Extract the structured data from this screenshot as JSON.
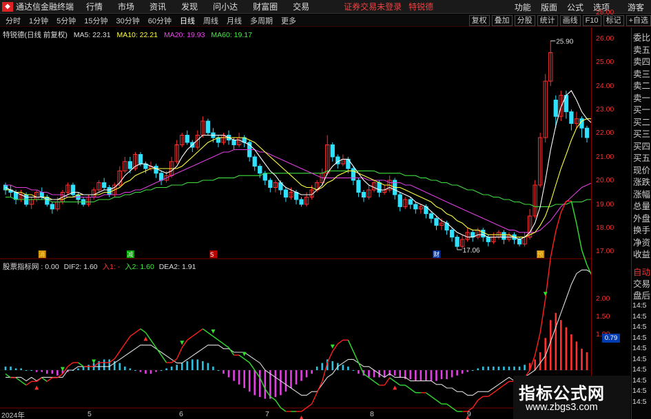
{
  "app": {
    "title": "通达信金融终端",
    "logo": "logo-icon"
  },
  "menu": [
    "行情",
    "市场",
    "资讯",
    "发现",
    "问小达",
    "财富圈",
    "交易"
  ],
  "login_text": "证券交易未登录",
  "stock_name": "特锐德",
  "top_right": [
    "功能",
    "版面",
    "公式",
    "选项"
  ],
  "guest": "游客",
  "periods": [
    "分时",
    "1分钟",
    "5分钟",
    "15分钟",
    "30分钟",
    "60分钟",
    "日线",
    "周线",
    "月线",
    "多周期",
    "更多"
  ],
  "active_period": "日线",
  "right_tools": [
    "复权",
    "叠加",
    "分股",
    "统计",
    "画线",
    "F10",
    "标记",
    "+自选"
  ],
  "legend": {
    "stock_label": "特锐德(日线 前复权)",
    "ma5": "MA5: 22.31",
    "ma10": "MA10: 22.21",
    "ma20": "MA20: 19.93",
    "ma60": "MA60: 19.17"
  },
  "indicator_legend": {
    "name": "股票指标网 : 0.00",
    "dif2": "DIF2: 1.60",
    "in1": "入1: -",
    "in2": "入2: 1.60",
    "dea2": "DEA2: 1.91"
  },
  "dea_box": "0.79",
  "right_panel_items": [
    "委比",
    "卖五",
    "卖四",
    "卖三",
    "卖二",
    "卖一",
    "买一",
    "买二",
    "买三",
    "买四",
    "买五",
    "现价",
    "涨跌",
    "涨幅",
    "总量",
    "外盘",
    "换手",
    "净资",
    "收益"
  ],
  "right_panel_lower": [
    "自动",
    "交易",
    "盘后"
  ],
  "right_panel_times": [
    "14:5",
    "14:5",
    "14:5",
    "14:5",
    "14:5",
    "14:5",
    "14:5",
    "14:5",
    "14:5",
    "14:5"
  ],
  "x_labels": [
    "2024年",
    "5",
    "6",
    "7",
    "8",
    "9"
  ],
  "event_markers": [
    "消",
    "减",
    "S",
    "财",
    "预"
  ],
  "price_labels": {
    "high": "25.90",
    "low": "17.06"
  },
  "watermark": {
    "title": "指标公式网",
    "url": "www.zbgs3.com"
  },
  "colors": {
    "up": "#ff3030",
    "down": "#30e0ff",
    "ma5": "#ffffff",
    "ma10": "#ffff40",
    "ma20": "#e040e0",
    "ma60": "#40e040",
    "dif": "#ffffff",
    "dea": "#ffff40",
    "grid": "#7a0000"
  },
  "chart_data": [
    {
      "type": "candlestick",
      "y_ticks": [
        17.0,
        18.0,
        19.0,
        20.0,
        21.0,
        22.0,
        23.0,
        24.0,
        25.0,
        26.0,
        28.0
      ],
      "ylim": [
        16.8,
        28.3
      ],
      "candles": [
        [
          19.8,
          19.6,
          19.9,
          19.4
        ],
        [
          19.6,
          19.5,
          19.8,
          19.3
        ],
        [
          19.5,
          19.2,
          19.6,
          19.0
        ],
        [
          19.2,
          19.4,
          19.6,
          19.1
        ],
        [
          19.4,
          19.0,
          19.5,
          18.9
        ],
        [
          19.0,
          19.2,
          19.3,
          18.8
        ],
        [
          19.2,
          19.5,
          19.6,
          19.1
        ],
        [
          19.5,
          19.3,
          19.7,
          19.2
        ],
        [
          19.3,
          19.0,
          19.4,
          18.9
        ],
        [
          19.0,
          18.8,
          19.1,
          18.6
        ],
        [
          18.8,
          19.1,
          19.3,
          18.7
        ],
        [
          19.1,
          19.5,
          19.6,
          19.0
        ],
        [
          19.5,
          19.8,
          19.9,
          19.4
        ],
        [
          19.8,
          19.4,
          19.9,
          19.3
        ],
        [
          19.4,
          19.2,
          19.5,
          19.0
        ],
        [
          19.2,
          19.0,
          19.3,
          18.9
        ],
        [
          19.0,
          19.3,
          19.4,
          18.9
        ],
        [
          19.3,
          19.6,
          19.7,
          19.2
        ],
        [
          19.6,
          19.9,
          20.0,
          19.5
        ],
        [
          19.9,
          19.7,
          20.1,
          19.6
        ],
        [
          19.7,
          19.4,
          19.8,
          19.3
        ],
        [
          19.4,
          19.8,
          19.9,
          19.3
        ],
        [
          19.8,
          20.4,
          20.6,
          19.7
        ],
        [
          20.4,
          20.8,
          21.0,
          20.3
        ],
        [
          20.8,
          20.5,
          21.0,
          20.3
        ],
        [
          20.5,
          21.1,
          21.2,
          20.4
        ],
        [
          21.1,
          20.7,
          21.2,
          20.6
        ],
        [
          20.7,
          20.5,
          20.8,
          20.3
        ],
        [
          20.5,
          20.6,
          20.8,
          20.4
        ],
        [
          20.6,
          20.3,
          20.7,
          20.1
        ],
        [
          20.3,
          20.0,
          20.4,
          19.8
        ],
        [
          20.0,
          20.2,
          20.4,
          19.9
        ],
        [
          20.2,
          20.8,
          21.0,
          20.1
        ],
        [
          20.8,
          21.5,
          21.7,
          20.7
        ],
        [
          21.5,
          21.9,
          22.0,
          21.4
        ],
        [
          21.9,
          21.6,
          22.1,
          21.5
        ],
        [
          21.6,
          21.4,
          21.7,
          21.2
        ],
        [
          21.4,
          21.9,
          22.1,
          21.3
        ],
        [
          21.9,
          22.5,
          22.7,
          21.8
        ],
        [
          22.5,
          22.0,
          22.6,
          21.9
        ],
        [
          22.0,
          21.8,
          22.2,
          21.6
        ],
        [
          21.8,
          21.6,
          21.9,
          21.4
        ],
        [
          21.6,
          21.9,
          22.0,
          21.5
        ],
        [
          21.9,
          21.7,
          22.1,
          21.5
        ],
        [
          21.7,
          21.5,
          21.8,
          21.3
        ],
        [
          21.5,
          21.8,
          22.0,
          21.4
        ],
        [
          21.8,
          21.6,
          21.9,
          21.4
        ],
        [
          21.6,
          21.0,
          21.7,
          20.8
        ],
        [
          21.0,
          20.6,
          21.1,
          20.4
        ],
        [
          20.6,
          20.3,
          20.7,
          20.1
        ],
        [
          20.3,
          20.0,
          20.4,
          19.8
        ],
        [
          20.0,
          19.7,
          20.1,
          19.5
        ],
        [
          19.7,
          19.9,
          20.0,
          19.5
        ],
        [
          19.9,
          19.6,
          20.0,
          19.4
        ],
        [
          19.6,
          19.3,
          19.7,
          19.1
        ],
        [
          19.3,
          19.5,
          19.7,
          19.2
        ],
        [
          19.5,
          19.2,
          19.6,
          19.0
        ],
        [
          19.2,
          19.0,
          19.3,
          18.9
        ],
        [
          19.0,
          19.3,
          19.5,
          18.9
        ],
        [
          19.3,
          19.6,
          19.8,
          19.2
        ],
        [
          19.6,
          19.9,
          20.0,
          19.5
        ],
        [
          19.9,
          20.3,
          20.5,
          19.8
        ],
        [
          20.3,
          21.5,
          21.9,
          20.2
        ],
        [
          21.5,
          21.0,
          21.6,
          20.8
        ],
        [
          21.0,
          20.7,
          21.1,
          20.5
        ],
        [
          20.7,
          20.9,
          21.1,
          20.6
        ],
        [
          20.9,
          20.5,
          21.0,
          20.3
        ],
        [
          20.5,
          20.0,
          20.6,
          19.8
        ],
        [
          20.0,
          19.5,
          20.1,
          19.3
        ],
        [
          19.5,
          19.3,
          19.6,
          19.1
        ],
        [
          19.3,
          19.6,
          19.8,
          19.2
        ],
        [
          19.6,
          19.9,
          20.0,
          19.5
        ],
        [
          19.9,
          19.5,
          20.0,
          19.3
        ],
        [
          19.5,
          19.6,
          19.8,
          19.4
        ],
        [
          19.6,
          20.0,
          20.2,
          19.5
        ],
        [
          20.0,
          19.4,
          20.1,
          19.2
        ],
        [
          19.4,
          18.9,
          19.5,
          18.7
        ],
        [
          18.9,
          19.2,
          19.3,
          18.8
        ],
        [
          19.2,
          19.0,
          19.3,
          18.8
        ],
        [
          19.0,
          18.8,
          19.1,
          18.6
        ],
        [
          18.8,
          18.9,
          19.0,
          18.6
        ],
        [
          18.9,
          18.6,
          19.0,
          18.4
        ],
        [
          18.6,
          18.4,
          18.7,
          18.2
        ],
        [
          18.4,
          18.1,
          18.5,
          17.9
        ],
        [
          18.1,
          18.2,
          18.4,
          17.9
        ],
        [
          18.2,
          17.9,
          18.3,
          17.7
        ],
        [
          17.9,
          17.6,
          18.0,
          17.4
        ],
        [
          17.6,
          17.2,
          17.7,
          17.06
        ],
        [
          17.2,
          17.5,
          17.7,
          17.1
        ],
        [
          17.5,
          17.8,
          18.0,
          17.4
        ],
        [
          17.8,
          17.6,
          17.9,
          17.4
        ],
        [
          17.6,
          17.9,
          18.0,
          17.5
        ],
        [
          17.9,
          17.6,
          18.0,
          17.4
        ],
        [
          17.6,
          17.4,
          17.7,
          17.2
        ],
        [
          17.4,
          17.6,
          17.8,
          17.3
        ],
        [
          17.6,
          17.8,
          17.9,
          17.5
        ],
        [
          17.8,
          17.5,
          17.9,
          17.3
        ],
        [
          17.5,
          17.7,
          17.8,
          17.4
        ],
        [
          17.7,
          17.5,
          17.8,
          17.3
        ],
        [
          17.5,
          17.3,
          17.6,
          17.2
        ],
        [
          17.3,
          17.6,
          17.8,
          17.2
        ],
        [
          17.6,
          18.5,
          18.8,
          17.5
        ],
        [
          18.5,
          19.8,
          20.0,
          18.4
        ],
        [
          19.8,
          21.8,
          22.0,
          19.7
        ],
        [
          21.8,
          24.2,
          24.5,
          21.6
        ],
        [
          24.2,
          25.4,
          25.9,
          24.0
        ],
        [
          23.4,
          22.7,
          23.6,
          22.2
        ],
        [
          22.7,
          23.6,
          23.8,
          22.5
        ],
        [
          23.6,
          22.9,
          23.8,
          22.6
        ],
        [
          22.9,
          22.4,
          23.0,
          22.1
        ],
        [
          22.4,
          22.6,
          22.9,
          22.2
        ],
        [
          22.6,
          22.2,
          22.7,
          21.8
        ],
        [
          22.2,
          21.8,
          22.3,
          21.6
        ]
      ],
      "ma5": [
        19.7,
        19.6,
        19.5,
        19.4,
        19.3,
        19.3,
        19.3,
        19.3,
        19.2,
        19.2,
        19.2,
        19.3,
        19.4,
        19.5,
        19.5,
        19.4,
        19.4,
        19.4,
        19.5,
        19.6,
        19.6,
        19.7,
        19.9,
        20.2,
        20.4,
        20.6,
        20.7,
        20.7,
        20.6,
        20.5,
        20.4,
        20.3,
        20.4,
        20.6,
        21.0,
        21.3,
        21.5,
        21.7,
        21.9,
        21.9,
        21.9,
        21.9,
        21.9,
        21.8,
        21.7,
        21.7,
        21.6,
        21.5,
        21.3,
        21.0,
        20.7,
        20.4,
        20.2,
        19.9,
        19.7,
        19.6,
        19.5,
        19.4,
        19.4,
        19.4,
        19.6,
        19.8,
        20.3,
        20.6,
        20.8,
        20.9,
        20.9,
        20.6,
        20.3,
        20.0,
        19.8,
        19.7,
        19.6,
        19.6,
        19.7,
        19.6,
        19.5,
        19.4,
        19.3,
        19.1,
        19.0,
        18.9,
        18.7,
        18.5,
        18.3,
        18.2,
        18.0,
        17.8,
        17.7,
        17.6,
        17.6,
        17.7,
        17.7,
        17.6,
        17.6,
        17.6,
        17.6,
        17.6,
        17.6,
        17.5,
        17.6,
        17.8,
        18.2,
        18.9,
        20.0,
        21.3,
        22.3,
        23.1,
        23.6,
        23.8,
        23.4,
        22.9,
        22.6,
        22.4
      ],
      "ma10": [
        19.6,
        19.6,
        19.5,
        19.5,
        19.4,
        19.4,
        19.3,
        19.3,
        19.3,
        19.2,
        19.2,
        19.2,
        19.3,
        19.3,
        19.4,
        19.4,
        19.4,
        19.4,
        19.4,
        19.5,
        19.5,
        19.6,
        19.7,
        19.9,
        20.0,
        20.2,
        20.3,
        20.4,
        20.5,
        20.5,
        20.5,
        20.5,
        20.5,
        20.5,
        20.6,
        20.8,
        21.0,
        21.2,
        21.4,
        21.6,
        21.7,
        21.8,
        21.8,
        21.8,
        21.8,
        21.8,
        21.8,
        21.7,
        21.6,
        21.4,
        21.2,
        21.0,
        20.8,
        20.6,
        20.4,
        20.2,
        20.0,
        19.8,
        19.7,
        19.7,
        19.6,
        19.7,
        19.9,
        20.0,
        20.2,
        20.3,
        20.4,
        20.4,
        20.3,
        20.2,
        20.1,
        20.0,
        19.9,
        19.8,
        19.8,
        19.7,
        19.7,
        19.6,
        19.5,
        19.4,
        19.3,
        19.2,
        19.1,
        18.9,
        18.8,
        18.6,
        18.5,
        18.3,
        18.2,
        18.0,
        17.9,
        17.9,
        17.8,
        17.7,
        17.7,
        17.7,
        17.7,
        17.7,
        17.6,
        17.6,
        17.6,
        17.7,
        17.8,
        18.1,
        18.5,
        19.1,
        19.8,
        20.5,
        21.1,
        21.7,
        22.2,
        22.5,
        22.6,
        22.6
      ],
      "ma20": [
        19.8,
        19.8,
        19.7,
        19.7,
        19.7,
        19.6,
        19.6,
        19.5,
        19.5,
        19.4,
        19.4,
        19.4,
        19.3,
        19.3,
        19.3,
        19.3,
        19.3,
        19.3,
        19.3,
        19.4,
        19.4,
        19.4,
        19.4,
        19.5,
        19.5,
        19.6,
        19.6,
        19.7,
        19.8,
        19.9,
        20.0,
        20.1,
        20.2,
        20.3,
        20.4,
        20.5,
        20.6,
        20.7,
        20.8,
        20.9,
        21.0,
        21.1,
        21.2,
        21.2,
        21.3,
        21.3,
        21.3,
        21.3,
        21.3,
        21.2,
        21.2,
        21.1,
        21.0,
        20.9,
        20.8,
        20.7,
        20.6,
        20.5,
        20.4,
        20.3,
        20.2,
        20.1,
        20.1,
        20.1,
        20.1,
        20.1,
        20.1,
        20.1,
        20.1,
        20.1,
        20.0,
        20.0,
        20.0,
        20.0,
        19.9,
        19.9,
        19.9,
        19.8,
        19.8,
        19.7,
        19.6,
        19.5,
        19.4,
        19.3,
        19.2,
        19.1,
        19.0,
        18.9,
        18.8,
        18.7,
        18.6,
        18.5,
        18.4,
        18.3,
        18.2,
        18.1,
        18.0,
        17.9,
        17.9,
        17.8,
        17.8,
        17.8,
        17.8,
        17.9,
        18.1,
        18.3,
        18.6,
        18.9,
        19.1,
        19.3,
        19.5,
        19.7,
        19.8,
        19.9
      ],
      "ma60": [
        19.3,
        19.3,
        19.2,
        19.2,
        19.2,
        19.2,
        19.2,
        19.2,
        19.2,
        19.1,
        19.1,
        19.1,
        19.1,
        19.1,
        19.1,
        19.1,
        19.1,
        19.1,
        19.2,
        19.2,
        19.2,
        19.3,
        19.3,
        19.4,
        19.4,
        19.5,
        19.5,
        19.6,
        19.6,
        19.7,
        19.7,
        19.7,
        19.8,
        19.8,
        19.8,
        19.9,
        19.9,
        19.9,
        20.0,
        20.0,
        20.0,
        20.1,
        20.1,
        20.1,
        20.1,
        20.2,
        20.2,
        20.2,
        20.2,
        20.2,
        20.3,
        20.3,
        20.3,
        20.3,
        20.3,
        20.3,
        20.3,
        20.3,
        20.3,
        20.3,
        20.3,
        20.3,
        20.4,
        20.4,
        20.4,
        20.4,
        20.4,
        20.4,
        20.4,
        20.4,
        20.4,
        20.4,
        20.3,
        20.3,
        20.3,
        20.3,
        20.3,
        20.2,
        20.2,
        20.2,
        20.1,
        20.1,
        20.0,
        20.0,
        19.9,
        19.9,
        19.8,
        19.8,
        19.7,
        19.6,
        19.6,
        19.5,
        19.4,
        19.4,
        19.3,
        19.3,
        19.2,
        19.2,
        19.1,
        19.1,
        19.0,
        19.0,
        18.9,
        18.9,
        18.9,
        18.9,
        19.0,
        19.0,
        19.0,
        19.1,
        19.1,
        19.1,
        19.2,
        19.2
      ]
    },
    {
      "type": "bar",
      "y_ticks": [
        1.0,
        1.5,
        2.0
      ],
      "ylim": [
        -1.3,
        2.8
      ],
      "macd": [
        0.1,
        0.1,
        0.05,
        0.05,
        0.0,
        0.0,
        -0.05,
        -0.05,
        -0.1,
        -0.1,
        -0.15,
        -0.1,
        -0.05,
        0.0,
        0.05,
        0.1,
        0.15,
        0.2,
        0.25,
        0.3,
        0.3,
        0.25,
        0.2,
        0.1,
        0.05,
        0.0,
        -0.05,
        -0.1,
        -0.1,
        -0.05,
        0.0,
        0.05,
        0.1,
        0.15,
        0.2,
        0.25,
        0.3,
        0.3,
        0.25,
        0.2,
        0.1,
        0.0,
        -0.1,
        -0.2,
        -0.3,
        -0.4,
        -0.5,
        -0.6,
        -0.7,
        -0.75,
        -0.8,
        -0.8,
        -0.75,
        -0.7,
        -0.6,
        -0.5,
        -0.4,
        -0.3,
        -0.2,
        -0.1,
        0.1,
        0.2,
        0.3,
        0.25,
        0.2,
        0.15,
        0.1,
        0.0,
        -0.1,
        -0.15,
        -0.2,
        -0.2,
        -0.2,
        -0.2,
        -0.15,
        -0.15,
        -0.2,
        -0.25,
        -0.25,
        -0.3,
        -0.3,
        -0.3,
        -0.3,
        -0.3,
        -0.25,
        -0.25,
        -0.2,
        -0.15,
        -0.1,
        -0.05,
        0.0,
        0.05,
        0.1,
        0.1,
        0.1,
        0.1,
        0.1,
        0.1,
        0.1,
        0.1,
        0.15,
        0.2,
        0.3,
        0.5,
        0.9,
        1.4,
        1.6,
        1.4,
        1.2,
        1.0,
        0.8,
        0.6,
        0.5,
        0.4
      ]
    }
  ]
}
